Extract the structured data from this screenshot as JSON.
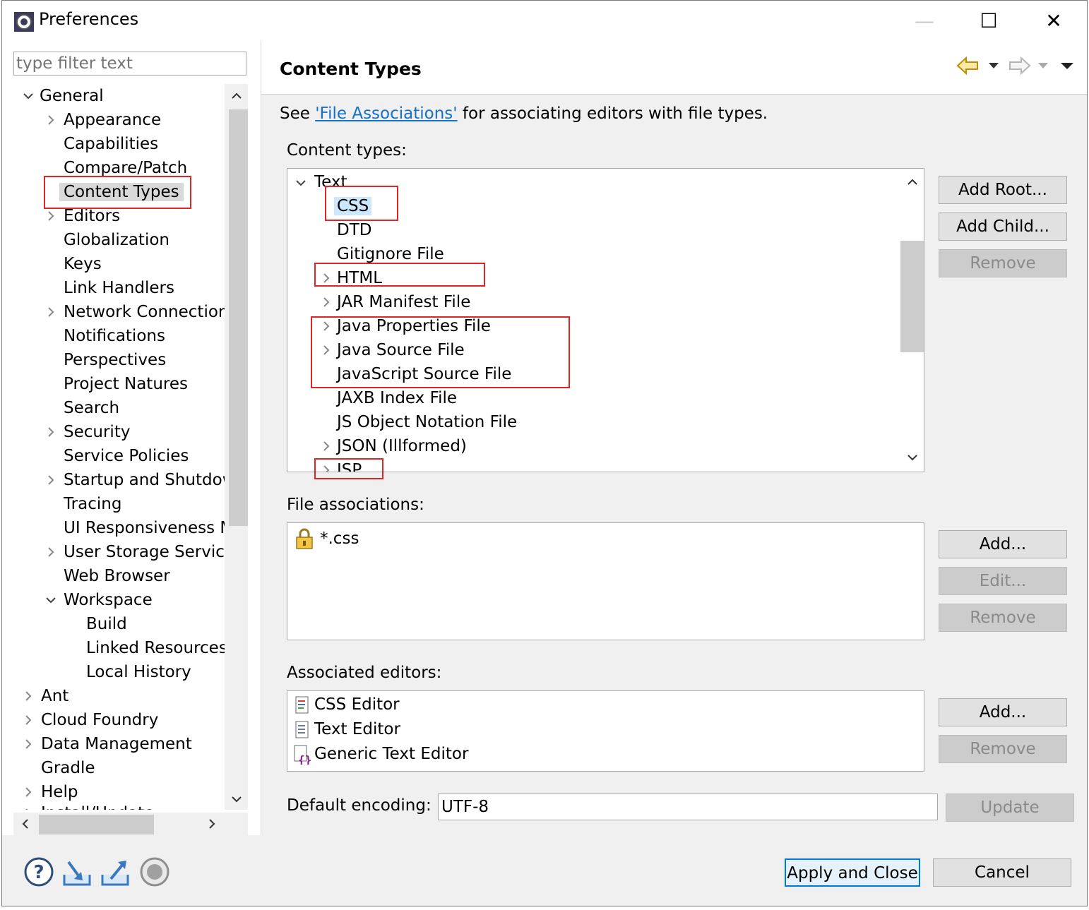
{
  "window": {
    "title": "Preferences",
    "controls": {
      "minimize": "—",
      "maximize": "☐",
      "close": "✕"
    }
  },
  "sidebar": {
    "filter_placeholder": "type filter text",
    "items": [
      {
        "label": "General",
        "expanded": true
      },
      {
        "label": "Appearance"
      },
      {
        "label": "Capabilities"
      },
      {
        "label": "Compare/Patch"
      },
      {
        "label": "Content Types",
        "selected": true
      },
      {
        "label": "Editors"
      },
      {
        "label": "Globalization"
      },
      {
        "label": "Keys"
      },
      {
        "label": "Link Handlers"
      },
      {
        "label": "Network Connection"
      },
      {
        "label": "Notifications"
      },
      {
        "label": "Perspectives"
      },
      {
        "label": "Project Natures"
      },
      {
        "label": "Search"
      },
      {
        "label": "Security"
      },
      {
        "label": "Service Policies"
      },
      {
        "label": "Startup and Shutdow"
      },
      {
        "label": "Tracing"
      },
      {
        "label": "UI Responsiveness M"
      },
      {
        "label": "User Storage Service"
      },
      {
        "label": "Web Browser"
      },
      {
        "label": "Workspace",
        "expanded": true
      },
      {
        "label": "Build"
      },
      {
        "label": "Linked Resources"
      },
      {
        "label": "Local History"
      },
      {
        "label": "Ant"
      },
      {
        "label": "Cloud Foundry"
      },
      {
        "label": "Data Management"
      },
      {
        "label": "Gradle"
      },
      {
        "label": "Help"
      },
      {
        "label": "Install/Update"
      }
    ]
  },
  "page": {
    "title": "Content Types",
    "intro_prefix": "See ",
    "intro_link": "'File Associations'",
    "intro_suffix": " for associating editors with file types.",
    "content_types_label": "Content types:",
    "content_types": [
      {
        "label": "Text",
        "expanded": true
      },
      {
        "label": "CSS",
        "selected": true
      },
      {
        "label": "DTD"
      },
      {
        "label": "Gitignore File"
      },
      {
        "label": "HTML"
      },
      {
        "label": "JAR Manifest File"
      },
      {
        "label": "Java Properties File"
      },
      {
        "label": "Java Source File"
      },
      {
        "label": "JavaScript Source File"
      },
      {
        "label": "JAXB Index File"
      },
      {
        "label": "JS Object Notation File"
      },
      {
        "label": "JSON (Illformed)"
      },
      {
        "label": "JSP"
      }
    ],
    "content_type_buttons": {
      "add_root": "Add Root...",
      "add_child": "Add Child...",
      "remove": "Remove"
    },
    "file_assoc_label": "File associations:",
    "file_associations": [
      "*.css"
    ],
    "file_assoc_buttons": {
      "add": "Add...",
      "edit": "Edit...",
      "remove": "Remove"
    },
    "editors_label": "Associated editors:",
    "editors": [
      "CSS Editor",
      "Text Editor",
      "Generic Text Editor"
    ],
    "editor_buttons": {
      "add": "Add...",
      "remove": "Remove"
    },
    "encoding_label": "Default encoding:",
    "encoding_value": "UTF-8",
    "update_button": "Update"
  },
  "footer": {
    "apply_close": "Apply and Close",
    "cancel": "Cancel"
  },
  "colors": {
    "highlight_box": "#e02525",
    "link": "#1570c8",
    "selection": "#cce8ff"
  }
}
